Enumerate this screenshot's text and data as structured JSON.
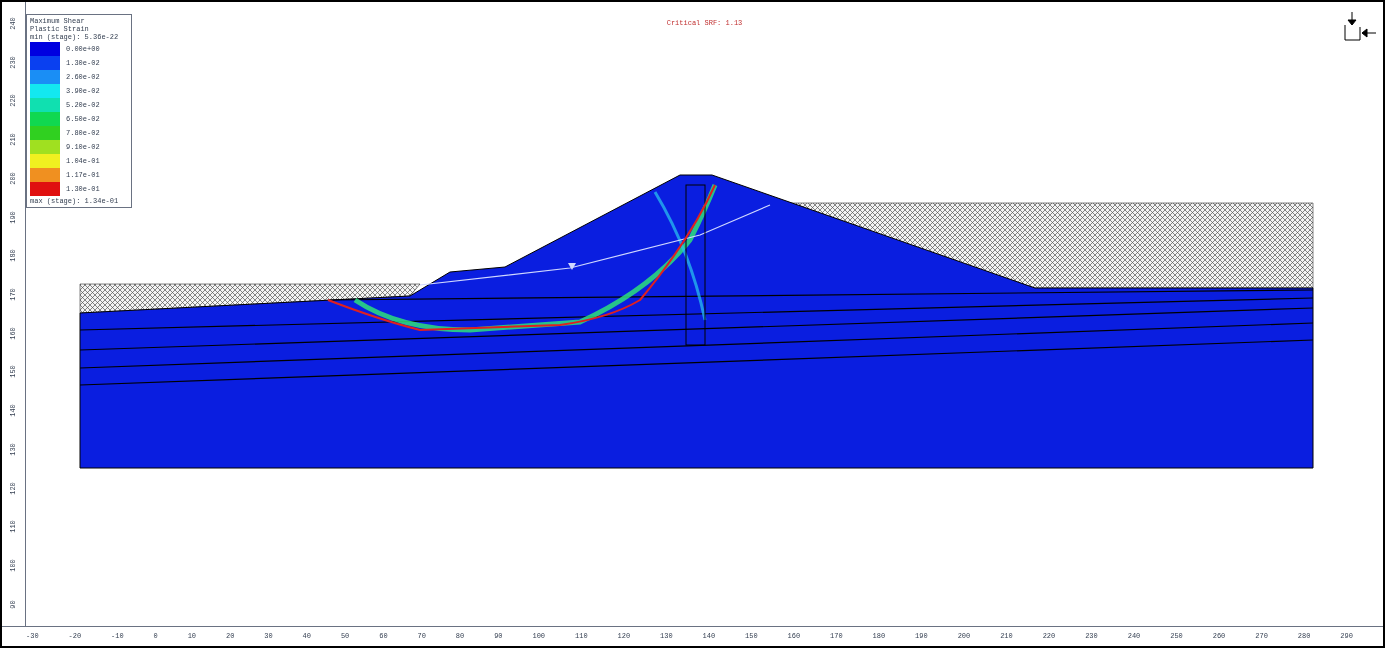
{
  "plot": {
    "title": "Critical SRF: 1.13"
  },
  "legend": {
    "title_lines": [
      "Maximum Shear",
      "Plastic Strain"
    ],
    "min": "min (stage): 5.36e-22",
    "max": "max (stage): 1.34e-01",
    "levels": [
      {
        "label": "0.00e+00",
        "color": "#0000e0"
      },
      {
        "label": "1.30e-02",
        "color": "#0a40f0"
      },
      {
        "label": "2.60e-02",
        "color": "#1a8ef5"
      },
      {
        "label": "3.90e-02",
        "color": "#13e8f0"
      },
      {
        "label": "5.20e-02",
        "color": "#10e0b0"
      },
      {
        "label": "6.50e-02",
        "color": "#10d850"
      },
      {
        "label": "7.80e-02",
        "color": "#30d020"
      },
      {
        "label": "9.10e-02",
        "color": "#a0e020"
      },
      {
        "label": "1.04e-01",
        "color": "#f0f020"
      },
      {
        "label": "1.17e-01",
        "color": "#f09020"
      },
      {
        "label": "1.30e-01",
        "color": "#e01010"
      }
    ]
  },
  "y_axis": {
    "labels": [
      "240",
      "230",
      "220",
      "210",
      "200",
      "190",
      "180",
      "170",
      "160",
      "150",
      "140",
      "130",
      "120",
      "110",
      "100",
      "90"
    ]
  },
  "x_axis": {
    "labels": [
      "-30",
      "-20",
      "-10",
      "0",
      "10",
      "20",
      "30",
      "40",
      "50",
      "60",
      "70",
      "80",
      "90",
      "100",
      "110",
      "120",
      "130",
      "140",
      "150",
      "160",
      "170",
      "180",
      "190",
      "200",
      "210",
      "220",
      "230",
      "240",
      "250",
      "260",
      "270",
      "280",
      "290"
    ]
  }
}
